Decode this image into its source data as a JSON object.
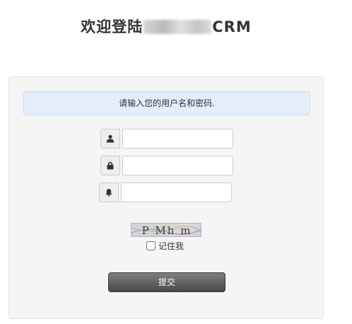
{
  "header": {
    "title_prefix": "欢迎登陆",
    "title_suffix": "CRM"
  },
  "login": {
    "alert_text": "请输入您的用户名和密码.",
    "username": {
      "value": "",
      "placeholder": "",
      "icon": "user-icon"
    },
    "password": {
      "value": "",
      "placeholder": "",
      "icon": "lock-icon"
    },
    "captcha": {
      "value": "",
      "placeholder": "",
      "icon": "bell-icon"
    },
    "captcha_image_text": "P Mh m",
    "remember_label": "记住我",
    "remember_checked": false,
    "submit_label": "提交"
  },
  "colors": {
    "alert_background": "#e4eefb",
    "panel_background": "#f5f5f5",
    "button_top": "#808080",
    "button_bottom": "#474747"
  }
}
